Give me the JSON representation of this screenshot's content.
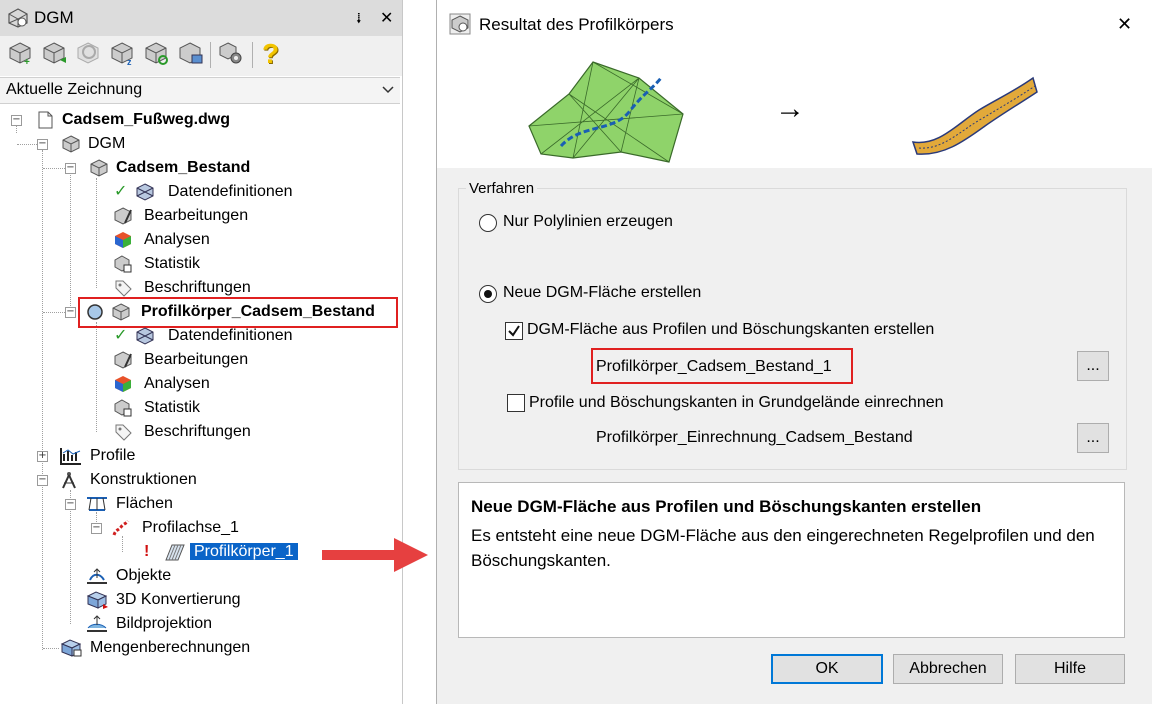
{
  "panel": {
    "title": "DGM",
    "pin_glyph": "⭭",
    "close_glyph": "✕",
    "dropdown_value": "Aktuelle Zeichnung",
    "toolbar_help_glyph": "?"
  },
  "tree": {
    "root": "Cadsem_Fußweg.dwg",
    "dgm": "DGM",
    "cadsem_bestand": "Cadsem_Bestand",
    "datendefinitionen_1": "Datendefinitionen",
    "bearbeitungen_1": "Bearbeitungen",
    "analysen_1": "Analysen",
    "statistik_1": "Statistik",
    "beschriftungen_1": "Beschriftungen",
    "profilkoerper_bestand": "Profilkörper_Cadsem_Bestand",
    "datendefinitionen_2": "Datendefinitionen",
    "bearbeitungen_2": "Bearbeitungen",
    "analysen_2": "Analysen",
    "statistik_2": "Statistik",
    "beschriftungen_2": "Beschriftungen",
    "profile": "Profile",
    "konstruktionen": "Konstruktionen",
    "flaechen": "Flächen",
    "profilachse": "Profilachse_1",
    "profilkoerper_1": "Profilkörper_1",
    "warning_glyph": "!",
    "objekte": "Objekte",
    "konvertierung": "3D Konvertierung",
    "bildprojektion": "Bildprojektion",
    "mengenberechnungen": "Mengenberechnungen"
  },
  "dialog": {
    "title": "Resultat des Profilkörpers",
    "close_glyph": "✕",
    "arrow_glyph": "→",
    "group_label": "Verfahren",
    "option_polylinien": "Nur Polylinien erzeugen",
    "option_dgm_flaeche": "Neue DGM-Fläche erstellen",
    "check_aus_profilen": "DGM-Fläche aus Profilen und Böschungskanten erstellen",
    "check_aus_profilen_checked": true,
    "name_field_1": "Profilkörper_Cadsem_Bestand_1",
    "check_grundgelaende": "Profile und Böschungskanten in Grundgelände einrechnen",
    "check_grundgelaende_checked": false,
    "name_field_2": "Profilkörper_Einrechnung_Cadsem_Bestand",
    "browse_label": "...",
    "desc_heading": "Neue DGM-Fläche aus Profilen und Böschungskanten erstellen",
    "desc_body": "Es entsteht eine neue DGM-Fläche aus den eingerechneten Regelprofilen und den Böschungskanten.",
    "ok_label": "OK",
    "cancel_label": "Abbrechen",
    "help_label": "Hilfe"
  },
  "colors": {
    "highlight_red": "#e02020",
    "selection_blue": "#0a64c8",
    "check_green": "#2a9a2a",
    "surface_green": "#8fd36a"
  }
}
